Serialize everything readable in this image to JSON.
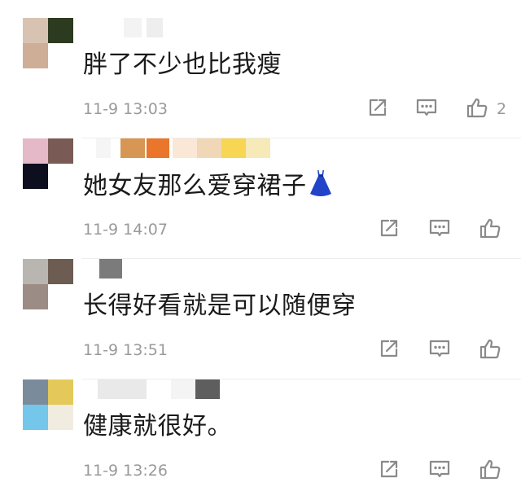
{
  "comments": [
    {
      "text": "胖了不少也比我瘦",
      "time": "11-9 13:03",
      "likes": "2",
      "avatar_colors": [
        "#d8c3b3",
        "#2c3a1f",
        "#cfae98",
        "#ffffff"
      ],
      "name_blocks": [
        {
          "color": "#f3f3f3",
          "w": 22
        },
        {
          "color": "#eeeeee",
          "w": 20
        }
      ]
    },
    {
      "text": "她女友那么爱穿裙子",
      "time": "11-9 14:07",
      "likes": "",
      "avatar_colors": [
        "#e5b9c8",
        "#7a5a55",
        "#0e0f1e",
        "#ffffff"
      ],
      "name_blocks": [
        {
          "color": "#f5f5f5",
          "w": 18
        },
        {
          "color": "#d79654",
          "w": 30
        },
        {
          "color": "#ffffff",
          "w": 28
        },
        {
          "color": "#e9762a",
          "w": 28
        },
        {
          "color": "#fbe7d6",
          "w": 30
        },
        {
          "color": "#f0d7b8",
          "w": 30
        },
        {
          "color": "#f6d653",
          "w": 30
        },
        {
          "color": "#f5eab8",
          "w": 30
        }
      ]
    },
    {
      "text": "长得好看就是可以随便穿",
      "time": "11-9 13:51",
      "likes": "",
      "avatar_colors": [
        "#b9b6b1",
        "#6d5c52",
        "#9c8c86",
        "#ffffff"
      ],
      "name_blocks": [
        {
          "color": "#7b7b7b",
          "w": 28
        }
      ]
    },
    {
      "text": "健康就很好。",
      "time": "11-9 13:26",
      "likes": "",
      "avatar_colors": [
        "#7a8c9c",
        "#e4c95a",
        "#74c6ea",
        "#f0ece0"
      ],
      "name_blocks": [
        {
          "color": "#e9e9e9",
          "w": 60
        },
        {
          "color": "#f4f4f4",
          "w": 30
        },
        {
          "color": "#5e5e5e",
          "w": 30
        }
      ]
    }
  ],
  "icons": {
    "share": "share-icon",
    "reply": "comment-icon",
    "like": "thumbs-up-icon",
    "dress_emoji": "dress-icon"
  }
}
